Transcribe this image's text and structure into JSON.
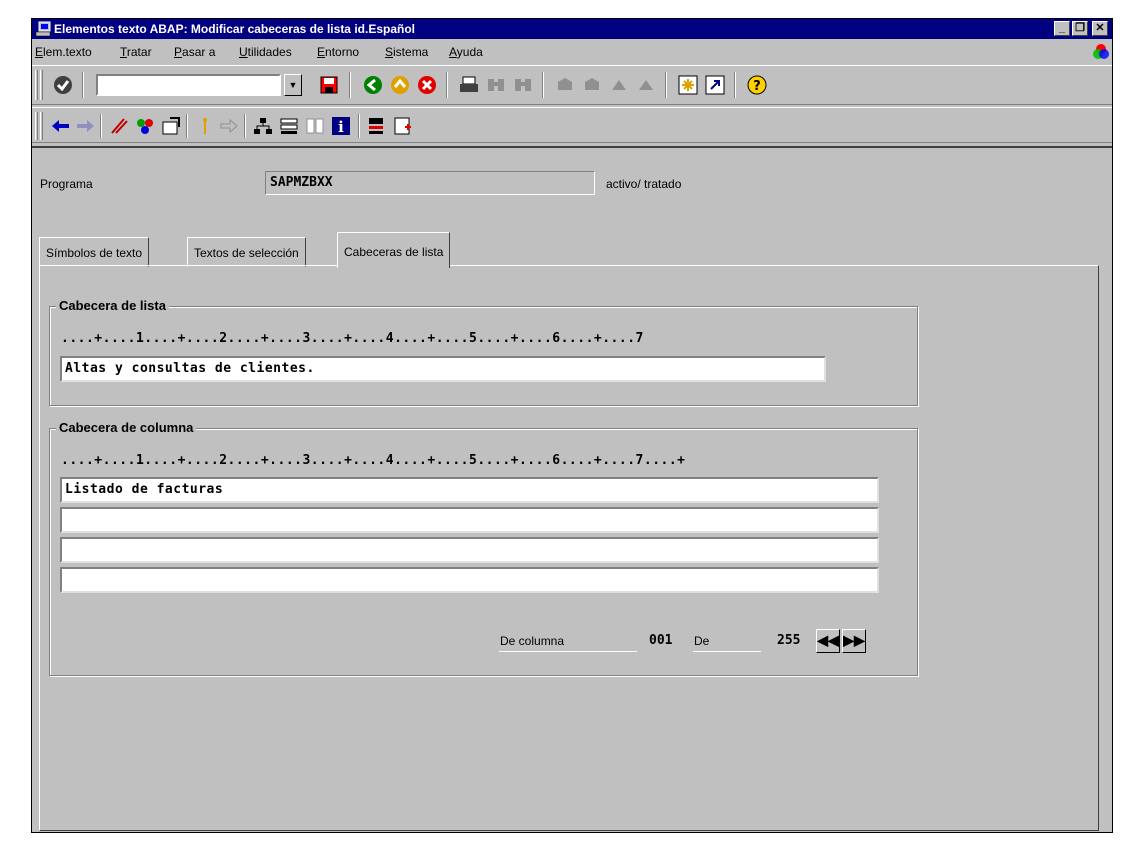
{
  "window": {
    "title": "Elementos texto ABAP: Modificar cabeceras de lista id.Español",
    "controls": [
      "_",
      "❐",
      "✕"
    ]
  },
  "menu": [
    {
      "label": "Elem.texto",
      "u": "E"
    },
    {
      "label": "Tratar",
      "u": "T"
    },
    {
      "label": "Pasar a",
      "u": "P"
    },
    {
      "label": "Utilidades",
      "u": "U"
    },
    {
      "label": "Entorno",
      "u": "E"
    },
    {
      "label": "Sistema",
      "u": "S"
    },
    {
      "label": "Ayuda",
      "u": "A"
    }
  ],
  "toolbar": {
    "command_value": ""
  },
  "header": {
    "program_label": "Programa",
    "program_value": "SAPMZBXX",
    "status": "activo/ tratado"
  },
  "tabs": [
    "Símbolos de texto",
    "Textos de selección",
    "Cabeceras de lista"
  ],
  "list_header": {
    "title": "Cabecera de lista",
    "ruler": "....+....1....+....2....+....3....+....4....+....5....+....6....+....7",
    "value": "Altas y consultas de clientes."
  },
  "column_header": {
    "title": "Cabecera de columna",
    "ruler": "....+....1....+....2....+....3....+....4....+....5....+....6....+....7....+",
    "lines": [
      "Listado de facturas",
      "",
      "",
      ""
    ],
    "from_column_label": "De columna",
    "from_column_value": "001",
    "of_label": "De",
    "of_value": "255"
  }
}
